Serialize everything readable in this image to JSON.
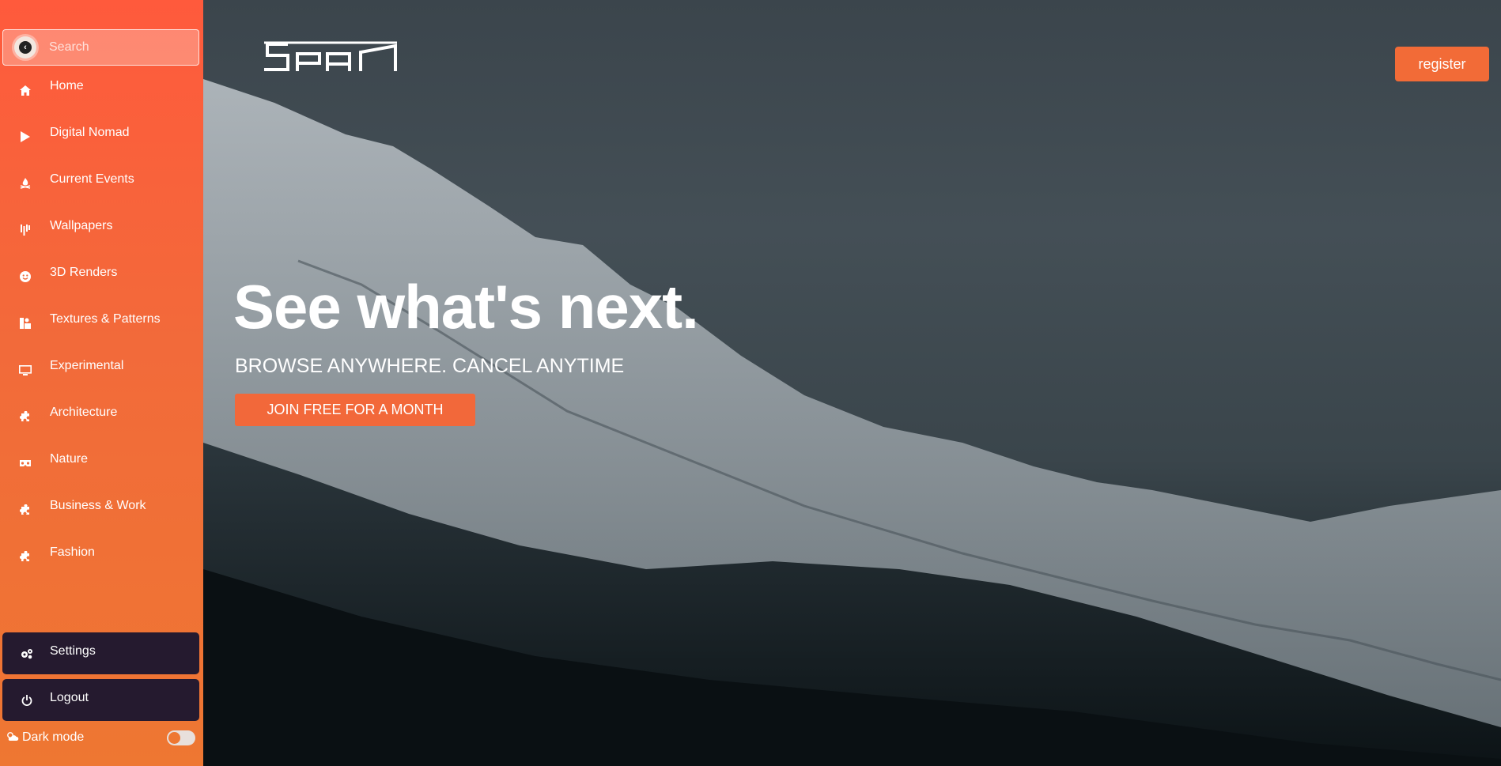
{
  "sidebar": {
    "search": {
      "placeholder": "Search",
      "toggle_icon": "chevron-left-icon"
    },
    "items": [
      {
        "label": "Home",
        "icon": "home-icon"
      },
      {
        "label": "Digital Nomad",
        "icon": "play-icon"
      },
      {
        "label": "Current Events",
        "icon": "campfire-icon"
      },
      {
        "label": "Wallpapers",
        "icon": "bars-icon"
      },
      {
        "label": "3D Renders",
        "icon": "smiley-icon"
      },
      {
        "label": "Textures & Patterns",
        "icon": "shapes-icon"
      },
      {
        "label": "Experimental",
        "icon": "monitor-icon"
      },
      {
        "label": "Architecture",
        "icon": "puzzle-icon"
      },
      {
        "label": "Nature",
        "icon": "vr-headset-icon"
      },
      {
        "label": "Business & Work",
        "icon": "puzzle-icon"
      },
      {
        "label": "Fashion",
        "icon": "puzzle-icon"
      }
    ],
    "settings": {
      "label": "Settings",
      "icon": "gears-icon"
    },
    "logout": {
      "label": "Logout",
      "icon": "power-icon"
    },
    "dark_mode": {
      "label": "Dark mode",
      "icon": "cloud-sun-icon",
      "enabled": false
    }
  },
  "header": {
    "register_label": "register"
  },
  "hero": {
    "headline": "See what's next.",
    "subline": "BROWSE ANYWHERE. CANCEL ANYTIME",
    "cta_label": "JOIN FREE FOR A MONTH"
  },
  "colors": {
    "sidebar_top": "#ff5a3c",
    "sidebar_bottom": "#ee7732",
    "accent": "#f26b37",
    "bottom_button": "#251a2f"
  }
}
